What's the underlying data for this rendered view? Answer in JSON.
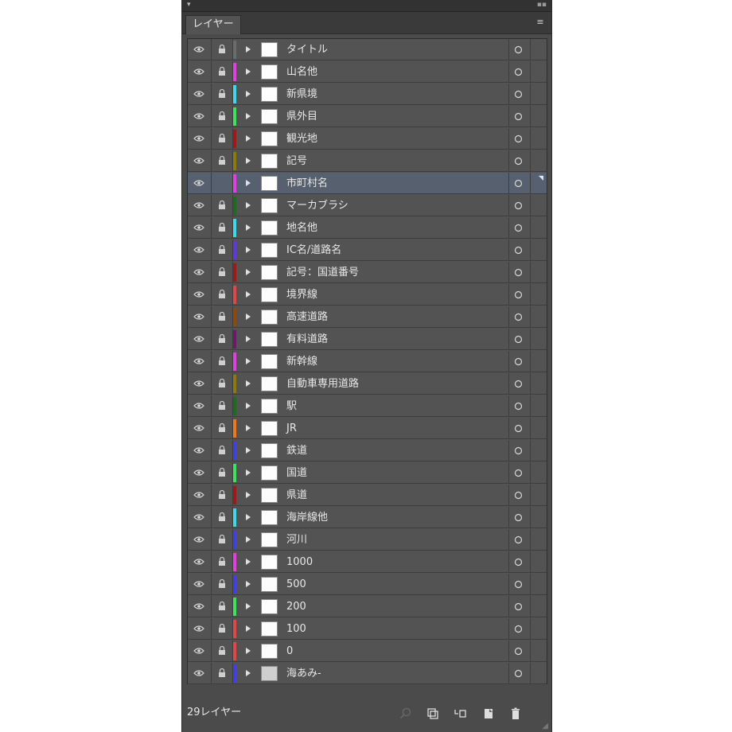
{
  "panel": {
    "tab_label": "レイヤー",
    "layer_count_label": "29レイヤー",
    "selected_index": 6,
    "icons": {
      "collapse": "collapse-arrows-icon",
      "menu": "panel-menu-icon",
      "visibility": "eye-icon",
      "lock": "lock-icon",
      "expand": "triangle-right-icon",
      "target": "target-circle-icon"
    },
    "footer_buttons": [
      {
        "name": "locate-object-button",
        "icon": "search-icon"
      },
      {
        "name": "make-clipping-mask-button",
        "icon": "clip-icon"
      },
      {
        "name": "create-sublayer-button",
        "icon": "new-sublayer-icon"
      },
      {
        "name": "create-layer-button",
        "icon": "new-layer-icon"
      },
      {
        "name": "delete-layer-button",
        "icon": "trash-icon"
      }
    ]
  },
  "layers": [
    {
      "name": "タイトル",
      "color": "#6b6b6b"
    },
    {
      "name": "山名他",
      "color": "#e040e0"
    },
    {
      "name": "新県境",
      "color": "#40d8e8"
    },
    {
      "name": "県外目",
      "color": "#40e060"
    },
    {
      "name": "観光地",
      "color": "#a01818"
    },
    {
      "name": "記号",
      "color": "#8a7a10"
    },
    {
      "name": "市町村名",
      "color": "#e040e0"
    },
    {
      "name": "マーカブラシ",
      "color": "#1e6a1e"
    },
    {
      "name": "地名他",
      "color": "#40d8e8"
    },
    {
      "name": "IC名/道路名",
      "color": "#6038e0"
    },
    {
      "name": "記号：国道番号",
      "color": "#a01818"
    },
    {
      "name": "境界線",
      "color": "#e04848"
    },
    {
      "name": "高速道路",
      "color": "#8a4a10"
    },
    {
      "name": "有料道路",
      "color": "#6a1a6a"
    },
    {
      "name": "新幹線",
      "color": "#e040e0"
    },
    {
      "name": "自動車専用道路",
      "color": "#8a7a10"
    },
    {
      "name": "駅",
      "color": "#1e6a1e"
    },
    {
      "name": "JR",
      "color": "#f07818"
    },
    {
      "name": "鉄道",
      "color": "#4040e0"
    },
    {
      "name": "国道",
      "color": "#40e060"
    },
    {
      "name": "県道",
      "color": "#a01818"
    },
    {
      "name": "海岸線他",
      "color": "#40d8e8"
    },
    {
      "name": "河川",
      "color": "#4040e0"
    },
    {
      "name": "1000",
      "color": "#e040e0"
    },
    {
      "name": "500",
      "color": "#4040e0"
    },
    {
      "name": "200",
      "color": "#40e060"
    },
    {
      "name": "100",
      "color": "#e04848"
    },
    {
      "name": "0",
      "color": "#e04848"
    },
    {
      "name": "海あみ-",
      "color": "#4040e0"
    }
  ]
}
